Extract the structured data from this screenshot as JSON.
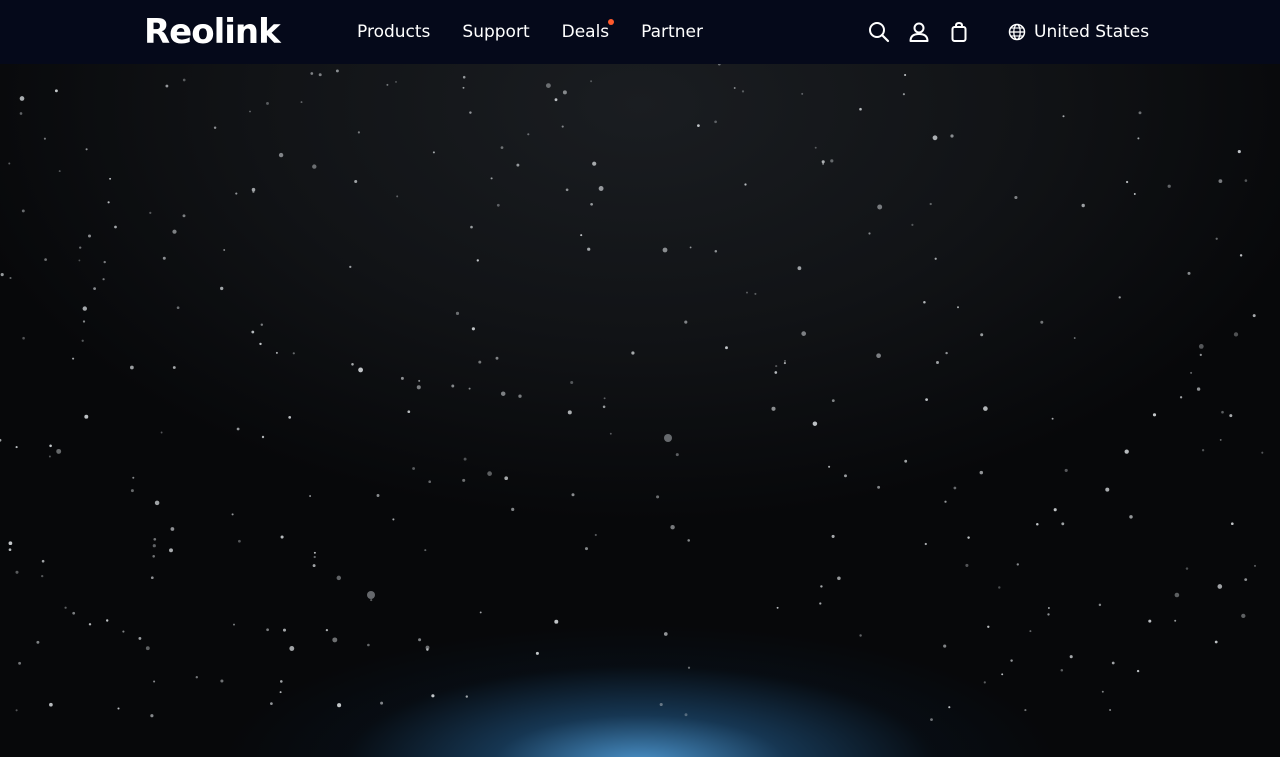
{
  "header": {
    "logo_text": "Reolink",
    "nav": [
      {
        "label": "Products"
      },
      {
        "label": "Support"
      },
      {
        "label": "Deals",
        "has_badge": true
      },
      {
        "label": "Partner"
      }
    ],
    "icons": [
      "search-icon",
      "user-icon",
      "cart-icon"
    ],
    "region_label": "United States",
    "colors": {
      "background": "#05091a",
      "text": "#ffffff",
      "badge": "#ff5a2c"
    }
  },
  "hero": {
    "background": "starfield",
    "colors": {
      "space": "#0b0c0e",
      "glow": "#3f8fd0",
      "star": "#cfd3d6"
    }
  }
}
